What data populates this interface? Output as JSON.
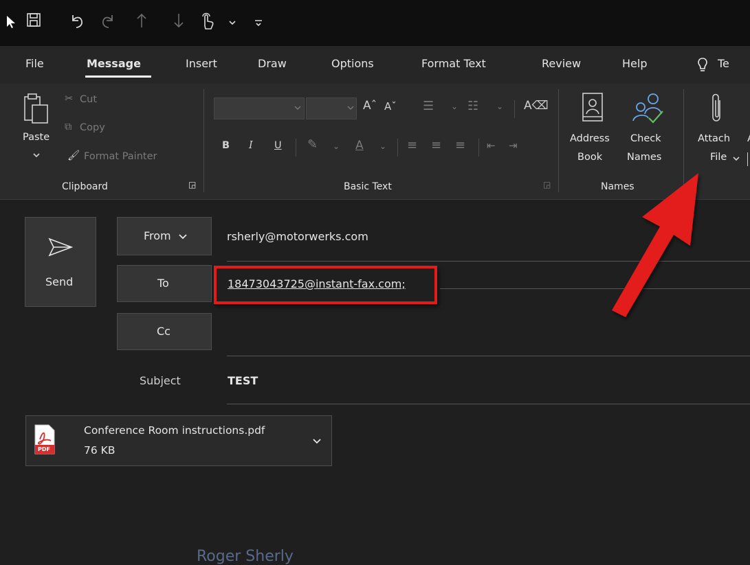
{
  "menu": {
    "items": [
      "File",
      "Message",
      "Insert",
      "Draw",
      "Options",
      "Format Text",
      "Review",
      "Help",
      "Te"
    ],
    "active": "Message"
  },
  "ribbon": {
    "clipboard": {
      "paste": "Paste",
      "cut": "Cut",
      "copy": "Copy",
      "format_painter": "Format Painter",
      "group_label": "Clipboard"
    },
    "basic_text": {
      "bold": "B",
      "italic": "I",
      "underline": "U",
      "group_label": "Basic Text"
    },
    "names": {
      "address_book_line1": "Address",
      "address_book_line2": "Book",
      "check_names_line1": "Check",
      "check_names_line2": "Names",
      "group_label": "Names"
    },
    "include": {
      "attach_line1": "Attach",
      "attach_line2": "File"
    }
  },
  "compose": {
    "send_label": "Send",
    "from_label": "From",
    "from_value": "rsherly@motorwerks.com",
    "to_label": "To",
    "to_value": "18473043725@instant-fax.com;",
    "cc_label": "Cc",
    "subject_label": "Subject",
    "subject_value": "TEST"
  },
  "attachment": {
    "filename": "Conference Room instructions.pdf",
    "size": "76 KB",
    "badge": "PDF"
  },
  "body_preview": "Roger Sherly",
  "icons": {
    "qat": [
      "cursor-icon",
      "save-icon",
      "undo-icon",
      "redo-icon",
      "arrow-up-icon",
      "arrow-down-icon",
      "touch-mode-icon",
      "customize-icon"
    ],
    "lightbulb": "lightbulb-icon"
  },
  "colors": {
    "highlight": "#e31b1b",
    "arrow": "#e31b1b",
    "pdf_red": "#d32f2f",
    "check_green": "#5fbf5f",
    "person_blue": "#6aa6e8"
  }
}
